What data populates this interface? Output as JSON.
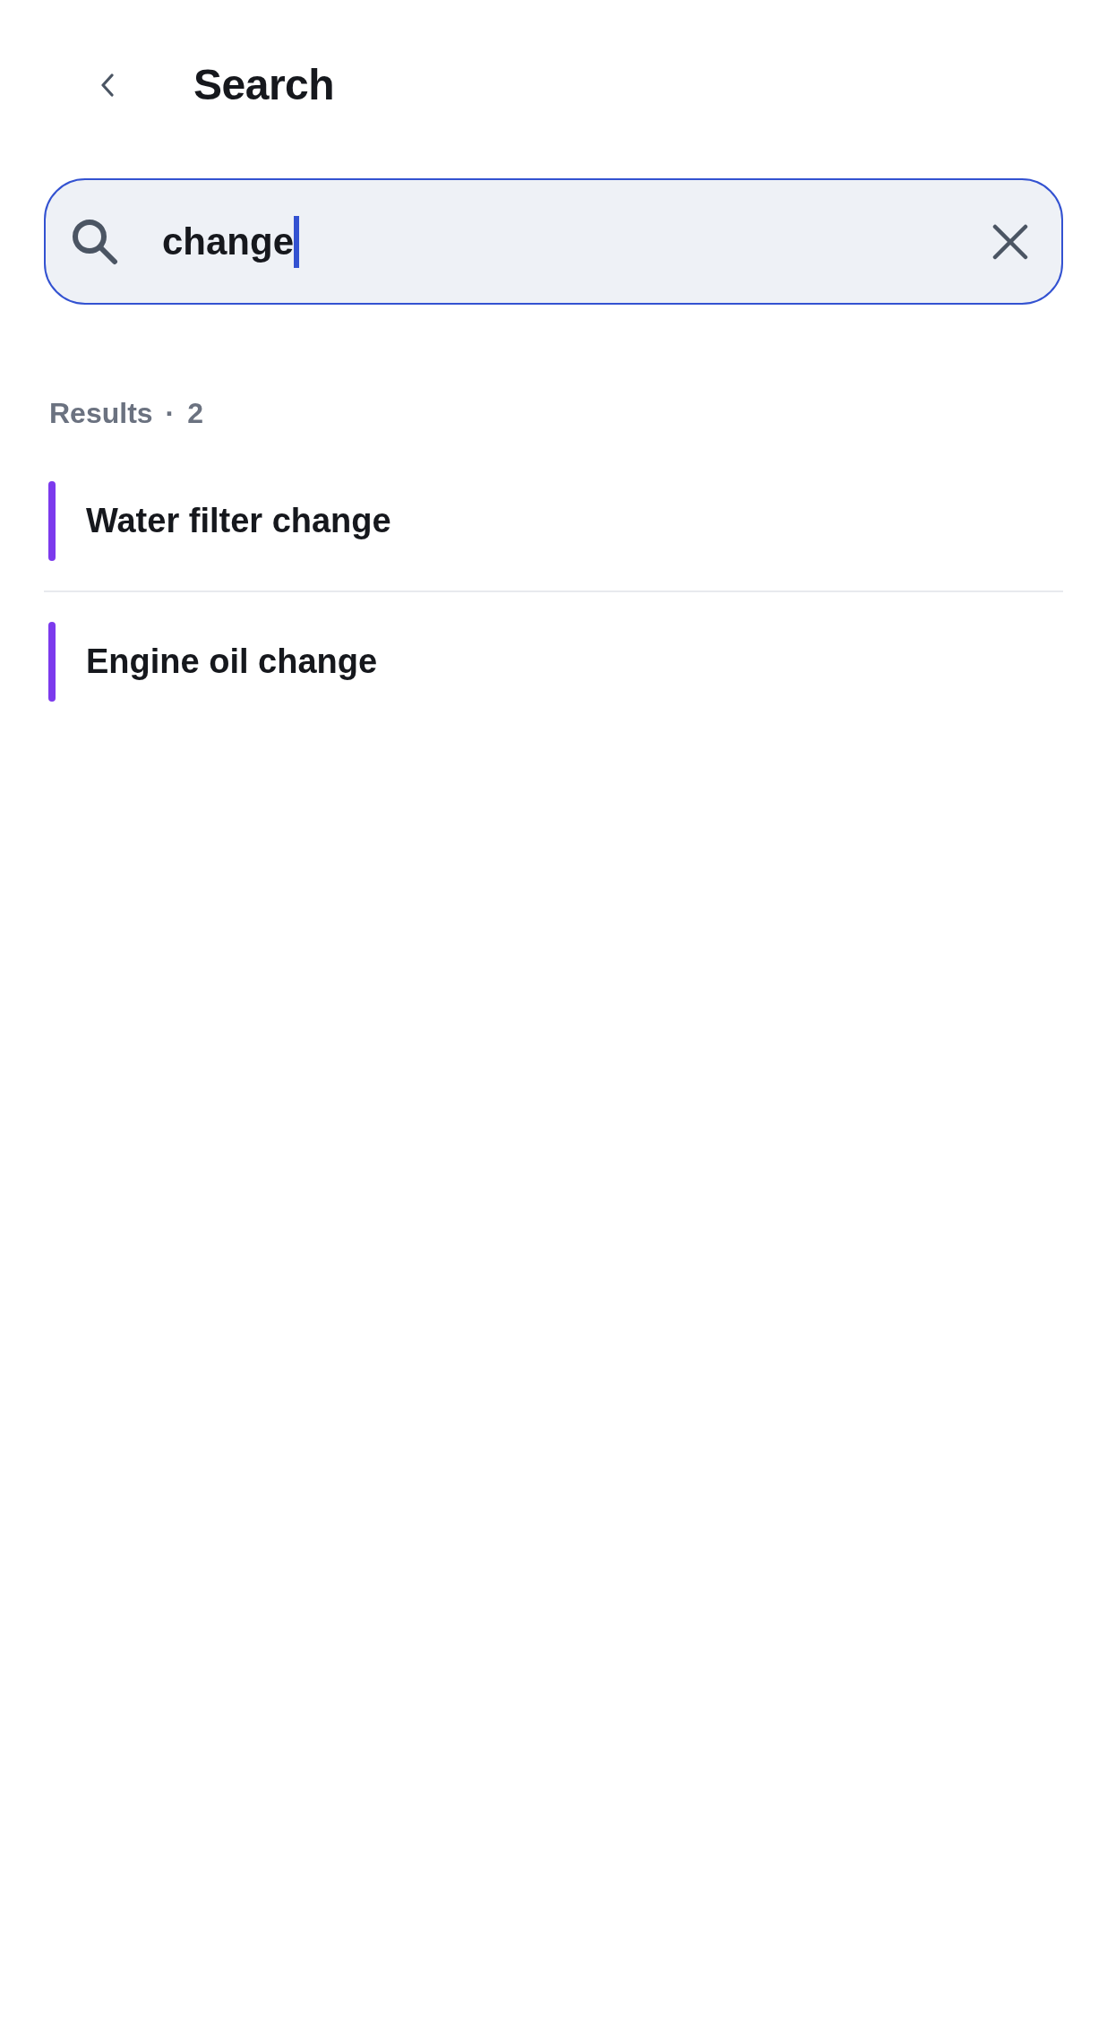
{
  "header": {
    "title": "Search"
  },
  "search": {
    "value": "change",
    "focused": true
  },
  "results": {
    "label": "Results",
    "separator": "·",
    "count": "2",
    "items": [
      {
        "title": "Water filter change",
        "color": "#7c3aed"
      },
      {
        "title": "Engine oil change",
        "color": "#7c3aed"
      }
    ]
  }
}
